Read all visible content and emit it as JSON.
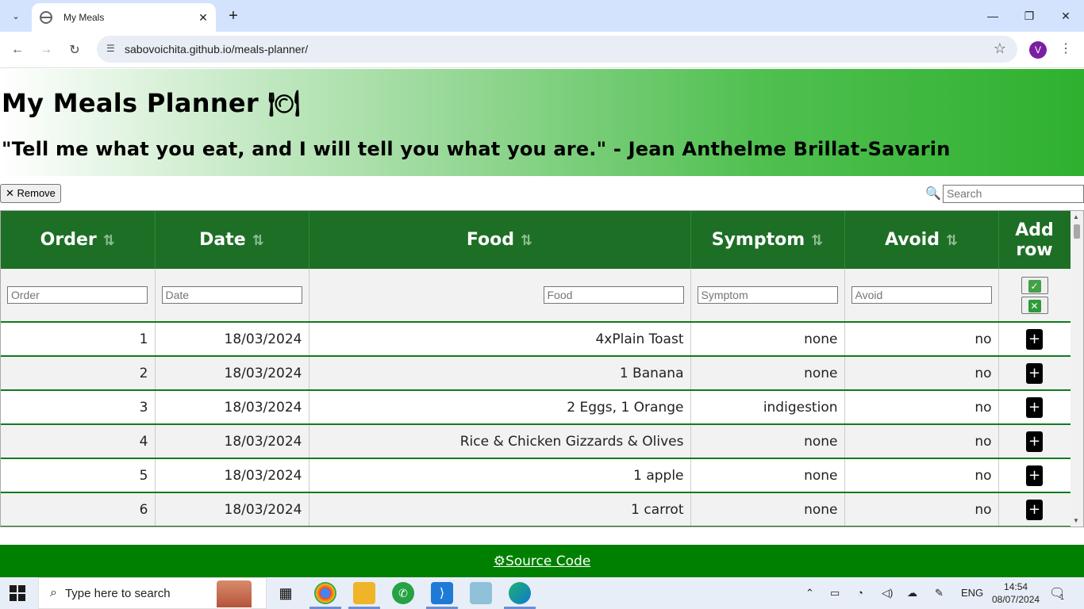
{
  "browser": {
    "tab_title": "My Meals",
    "url": "sabovoichita.github.io/meals-planner/",
    "profile_initial": "V"
  },
  "page": {
    "title": "My Meals Planner 🍽",
    "quote": "\"Tell me what you eat, and I will tell you what you are.\" - Jean Anthelme Brillat-Savarin",
    "remove_label": "✕ Remove",
    "search_placeholder": "Search",
    "columns": [
      "Order",
      "Date",
      "Food",
      "Symptom",
      "Avoid",
      "Add row"
    ],
    "add_row_line1": "Add",
    "add_row_line2": "row",
    "filters": {
      "order": "Order",
      "date": "Date",
      "food": "Food",
      "symptom": "Symptom",
      "avoid": "Avoid"
    },
    "rows": [
      {
        "order": "1",
        "date": "18/03/2024",
        "food": "4xPlain Toast",
        "symptom": "none",
        "avoid": "no"
      },
      {
        "order": "2",
        "date": "18/03/2024",
        "food": "1 Banana",
        "symptom": "none",
        "avoid": "no"
      },
      {
        "order": "3",
        "date": "18/03/2024",
        "food": "2 Eggs, 1 Orange",
        "symptom": "indigestion",
        "avoid": "no"
      },
      {
        "order": "4",
        "date": "18/03/2024",
        "food": "Rice & Chicken Gizzards & Olives",
        "symptom": "none",
        "avoid": "no"
      },
      {
        "order": "5",
        "date": "18/03/2024",
        "food": "1 apple",
        "symptom": "none",
        "avoid": "no"
      },
      {
        "order": "6",
        "date": "18/03/2024",
        "food": "1 carrot",
        "symptom": "none",
        "avoid": "no"
      }
    ],
    "plus_label": "+",
    "footer_link": "⚙Source Code"
  },
  "taskbar": {
    "search_placeholder": "Type here to search",
    "language": "ENG",
    "time": "14:54",
    "date": "08/07/2024",
    "notification_count": "1"
  }
}
